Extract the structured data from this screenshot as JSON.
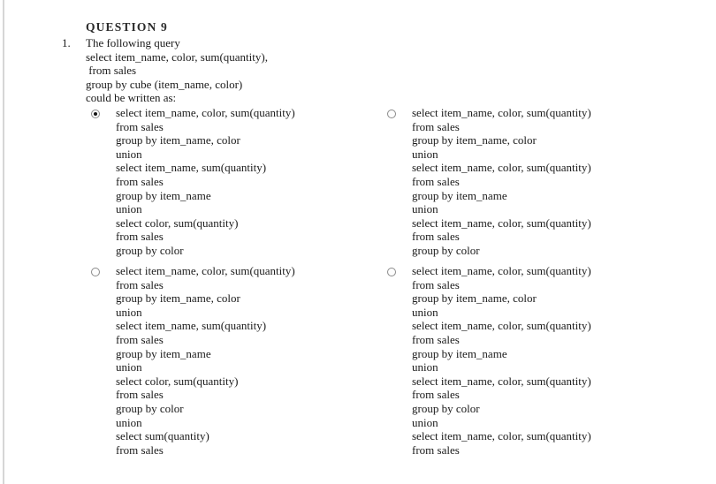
{
  "page": {
    "question_header": "QUESTION 9",
    "item_number": "1.",
    "background_color": "#ffffff",
    "text_color": "#1a1a1a"
  },
  "stem": {
    "lines": [
      "The following query",
      "select item_name, color, sum(quantity),",
      " from sales",
      "group by cube (item_name, color)",
      "could be written as:"
    ]
  },
  "choices": {
    "selected_index": 0,
    "items": [
      {
        "id": "choice-a",
        "column": "left",
        "selected": true,
        "lines": [
          "select item_name, color, sum(quantity)",
          "from sales",
          "group by item_name, color",
          "union",
          "select item_name, sum(quantity)",
          "from sales",
          "group by item_name",
          "union",
          "select color, sum(quantity)",
          "from sales",
          "group by color"
        ]
      },
      {
        "id": "choice-b",
        "column": "right",
        "selected": false,
        "lines": [
          "select item_name, color, sum(quantity)",
          "from sales",
          "group by item_name, color",
          "union",
          "select item_name, color, sum(quantity)",
          "from sales",
          "group by item_name",
          "union",
          "select item_name, color, sum(quantity)",
          "from sales",
          "group by color"
        ]
      },
      {
        "id": "choice-c",
        "column": "left",
        "selected": false,
        "lines": [
          "select item_name, color, sum(quantity)",
          "from sales",
          "group by item_name, color",
          "union",
          "select item_name, sum(quantity)",
          "from sales",
          "group by item_name",
          "union",
          "select color, sum(quantity)",
          "from sales",
          "group by color",
          "union",
          "select sum(quantity)",
          "from sales"
        ]
      },
      {
        "id": "choice-d",
        "column": "right",
        "selected": false,
        "lines": [
          "select item_name, color, sum(quantity)",
          "from sales",
          "group by item_name, color",
          "union",
          "select item_name, color, sum(quantity)",
          "from sales",
          "group by item_name",
          "union",
          "select item_name, color, sum(quantity)",
          "from sales",
          "group by color",
          "union",
          "select item_name, color, sum(quantity)",
          "from sales"
        ]
      }
    ]
  }
}
